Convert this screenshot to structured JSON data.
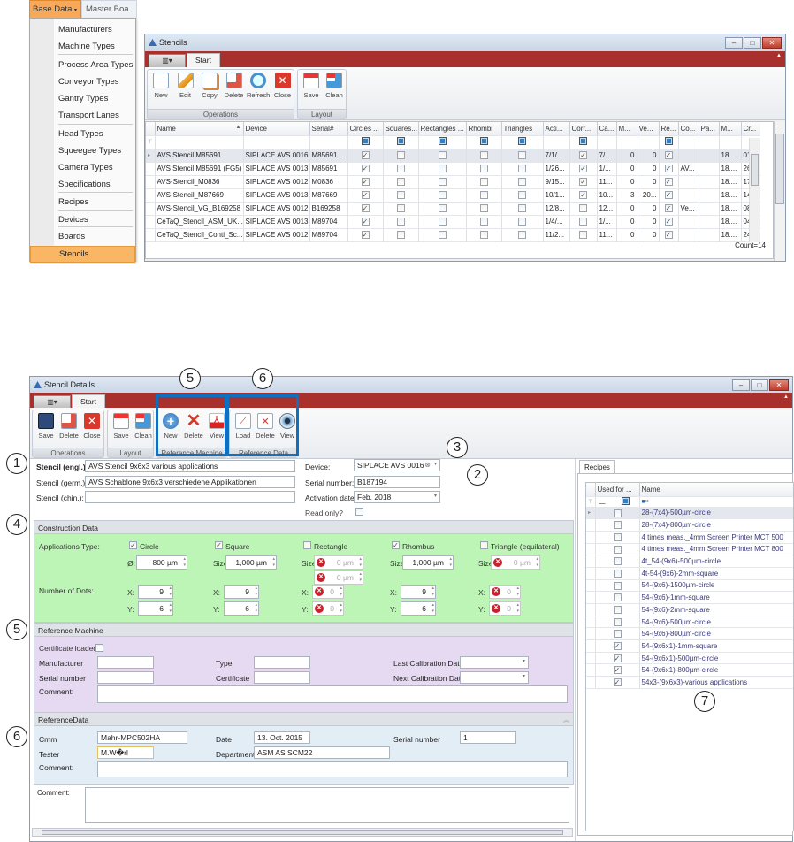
{
  "menu": {
    "base_data": "Base Data",
    "master_boards": "Master Boa",
    "items": [
      "Manufacturers",
      "Machine Types",
      "Process Area Types",
      "Conveyor Types",
      "Gantry Types",
      "Transport Lanes",
      "Head Types",
      "Squeegee Types",
      "Camera Types",
      "Specifications",
      "Recipes",
      "Devices",
      "Boards",
      "Stencils"
    ],
    "selected": "Stencils"
  },
  "stencils": {
    "title": "Stencils",
    "tab": "Start",
    "ops": {
      "label": "Operations",
      "buttons": [
        "New",
        "Edit",
        "Copy",
        "Delete",
        "Refresh",
        "Close"
      ]
    },
    "layout": {
      "label": "Layout",
      "buttons": [
        "Save",
        "Clean"
      ]
    },
    "columns": [
      "Name",
      "Device",
      "Serial#",
      "Circles ...",
      "Squares...",
      "Rectangles ...",
      "Rhombi",
      "Triangles",
      "Acti...",
      "Corr...",
      "Ca...",
      "M...",
      "Ve...",
      "Re...",
      "Co...",
      "Pa...",
      "M...",
      "Cr..."
    ],
    "rows": [
      [
        "AVS Stencil M85691",
        "SIPLACE AVS 0016",
        "M85691...",
        true,
        false,
        false,
        false,
        false,
        "7/1/...",
        true,
        "7/...",
        "0",
        "0",
        true,
        "",
        "",
        "18....",
        "01...."
      ],
      [
        "AVS Stencil M85691 (FG5)",
        "SIPLACE AVS 0013",
        "M85691",
        true,
        false,
        false,
        false,
        false,
        "1/26...",
        true,
        "1/...",
        "0",
        "0",
        true,
        "AV...",
        "",
        "18....",
        "26...."
      ],
      [
        "AVS-Stencil_M0836",
        "SIPLACE AVS 0012",
        "M0836",
        true,
        false,
        false,
        false,
        false,
        "9/15...",
        true,
        "11...",
        "0",
        "0",
        true,
        "",
        "",
        "18....",
        "17...."
      ],
      [
        "AVS-Stencil_M87669",
        "SIPLACE AVS 0013",
        "M87669",
        true,
        false,
        false,
        false,
        false,
        "10/1...",
        true,
        "10...",
        "3",
        "20...",
        true,
        "",
        "",
        "18....",
        "14...."
      ],
      [
        "AVS-Stencil_VG_B169258",
        "SIPLACE AVS 0012",
        "B169258",
        true,
        false,
        false,
        false,
        false,
        "12/8...",
        false,
        "12...",
        "0",
        "0",
        true,
        "Ve...",
        "",
        "18....",
        "08...."
      ],
      [
        "CeTaQ_Stencil_ASM_UK...",
        "SIPLACE AVS 0013",
        "M89704",
        true,
        false,
        false,
        false,
        false,
        "1/4/...",
        false,
        "1/...",
        "0",
        "0",
        true,
        "",
        "",
        "18....",
        "04...."
      ],
      [
        "CeTaQ_Stencil_Conti_Sc...",
        "SIPLACE AVS 0012",
        "M89704",
        true,
        false,
        false,
        false,
        false,
        "11/2...",
        false,
        "11...",
        "0",
        "0",
        true,
        "",
        "",
        "18....",
        "24...."
      ]
    ],
    "count": "Count=14"
  },
  "details": {
    "title": "Stencil Details",
    "tab": "Start",
    "ops": {
      "label": "Operations",
      "buttons": [
        "Save",
        "Delete",
        "Close"
      ]
    },
    "layout": {
      "label": "Layout",
      "buttons": [
        "Save",
        "Clean"
      ]
    },
    "refmachine": {
      "label": "Reference Machine",
      "buttons": [
        "New",
        "Delete",
        "View"
      ]
    },
    "refdata": {
      "label": "Reference Data",
      "buttons": [
        "Load",
        "Delete",
        "View"
      ]
    },
    "form": {
      "engl_label": "Stencil (engl.):",
      "engl": "AVS Stencil 9x6x3 various applications",
      "germ_label": "Stencil (germ.):",
      "germ": "AVS Schablone 9x6x3 verschiedene Applikationen",
      "chin_label": "Stencil (chin.):",
      "chin": "",
      "device_label": "Device:",
      "device": "SIPLACE AVS 0016",
      "serial_label": "Serial number:",
      "serial": "B187194",
      "activation_label": "Activation date:",
      "activation": "Feb. 2018",
      "readonly_label": "Read only?"
    },
    "construction": {
      "title": "Construction Data",
      "app_type_label": "Applications Type:",
      "dots_label": "Number of Dots:",
      "types": [
        {
          "name": "Circle",
          "checked": true,
          "size_label": "Ø:",
          "size": "800 µm",
          "x": "9",
          "y": "6"
        },
        {
          "name": "Square",
          "checked": true,
          "size_label": "Size:",
          "size": "1,000 µm",
          "x": "9",
          "y": "6"
        },
        {
          "name": "Rectangle",
          "checked": false,
          "size_label": "Size:",
          "size": "0 µm",
          "size2": "0 µm",
          "x": "0",
          "y": "0"
        },
        {
          "name": "Rhombus",
          "checked": true,
          "size_label": "Size:",
          "size": "1,000 µm",
          "x": "9",
          "y": "6"
        },
        {
          "name": "Triangle (equilateral)",
          "checked": false,
          "size_label": "Size:",
          "size": "0 µm",
          "x": "0",
          "y": "0"
        }
      ],
      "x_label": "X:",
      "y_label": "Y:"
    },
    "refmach": {
      "title": "Reference Machine",
      "cert_loaded": "Certificate loaded?",
      "manufacturer": "Manufacturer",
      "serial": "Serial number",
      "type": "Type",
      "certificate": "Certificate",
      "last_cal": "Last Calibration Date",
      "next_cal": "Next Calibration Date",
      "comment": "Comment:"
    },
    "refdatasec": {
      "title": "ReferenceData",
      "cmm_label": "Cmm",
      "cmm": "Mahr-MPC502HA",
      "date_label": "Date",
      "date": "13. Oct. 2015",
      "serial_label": "Serial number",
      "serial": "1",
      "tester_label": "Tester",
      "tester": "M.W�rl",
      "dept_label": "Department",
      "dept": "ASM AS SCM22",
      "comment": "Comment:"
    },
    "comment_label": "Comment:",
    "recipes": {
      "tab": "Recipes",
      "col_used": "Used for ...",
      "col_name": "Name",
      "filter": "■×",
      "items": [
        [
          "28-(7x4)-500µm-circle",
          false
        ],
        [
          "28-(7x4)-800µm-circle",
          false
        ],
        [
          "4 times meas._4mm Screen Printer MCT 500",
          false
        ],
        [
          "4 times meas._4mm Screen Printer MCT 800",
          false
        ],
        [
          "4t_54-(9x6)-500µm-circle",
          false
        ],
        [
          "4t-54-(9x6)-2mm-square",
          false
        ],
        [
          "54-(9x6)-1500µm-circle",
          false
        ],
        [
          "54-(9x6)-1mm-square",
          false
        ],
        [
          "54-(9x6)-2mm-square",
          false
        ],
        [
          "54-(9x6)-500µm-circle",
          false
        ],
        [
          "54-(9x6)-800µm-circle",
          false
        ],
        [
          "54-(9x6x1)-1mm-square",
          true
        ],
        [
          "54-(9x6x1)-500µm-circle",
          true
        ],
        [
          "54-(9x6x1)-800µm-circle",
          true
        ],
        [
          "54x3-(9x6x3)-various applications",
          true
        ]
      ]
    }
  },
  "annotations": [
    "1",
    "2",
    "3",
    "4",
    "5",
    "6",
    "7"
  ]
}
